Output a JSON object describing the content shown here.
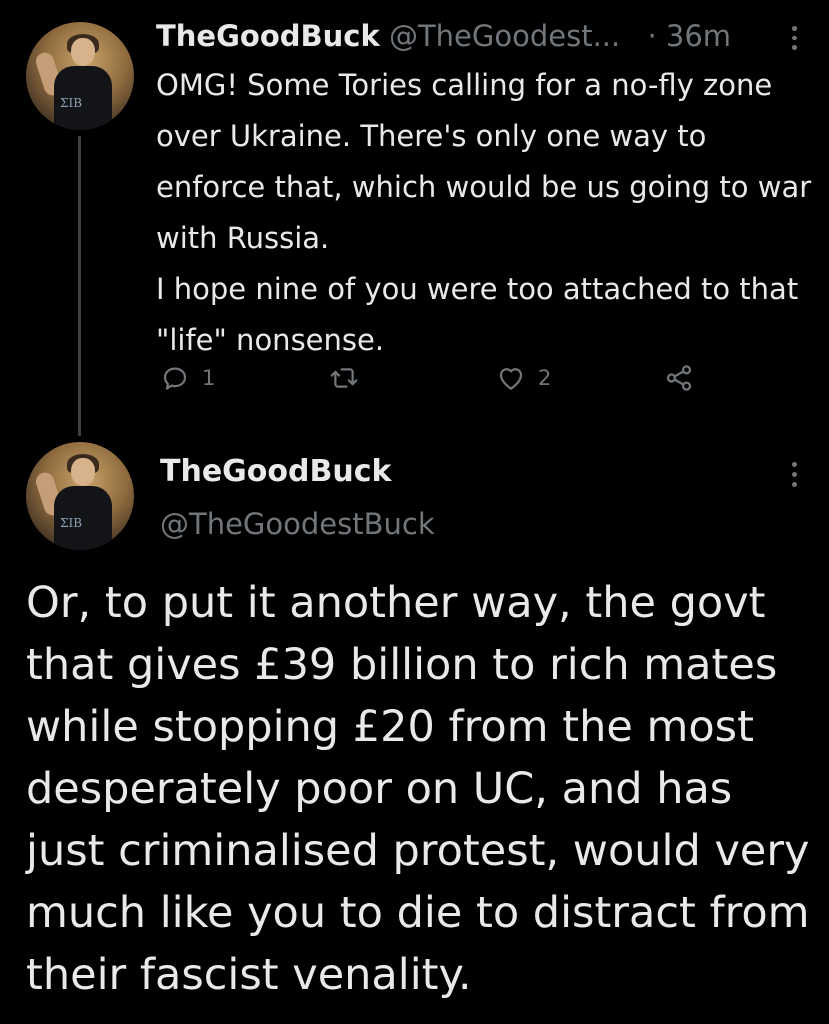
{
  "tweet1": {
    "name": "TheGoodBuck",
    "handle": "@TheGoodest...",
    "separator": "·",
    "time": "36m",
    "text_lines": [
      "OMG! Some Tories calling for a no-fly zone over Ukraine. There's only one way to enforce that, which would be us going to war with Russia.",
      "I hope nine of you were too attached to that \"life\" nonsense."
    ],
    "actions": {
      "reply_count": "1",
      "retweet_count": "",
      "like_count": "2"
    },
    "icons": [
      "reply-icon",
      "retweet-icon",
      "like-icon",
      "share-icon",
      "more-icon"
    ]
  },
  "tweet2": {
    "name": "TheGoodBuck",
    "handle": "@TheGoodestBuck",
    "text": "Or, to put it another way, the govt that gives £39 billion to rich mates while stopping £20 from the most desperately poor on UC, and has just criminalised protest, would very much like you to die to distract from their fascist venality."
  },
  "avatar_logo": "ΣIB",
  "colors": {
    "background": "#000000",
    "text": "#e7e9ea",
    "secondary": "#71767b",
    "thread_line": "#3e4144"
  }
}
